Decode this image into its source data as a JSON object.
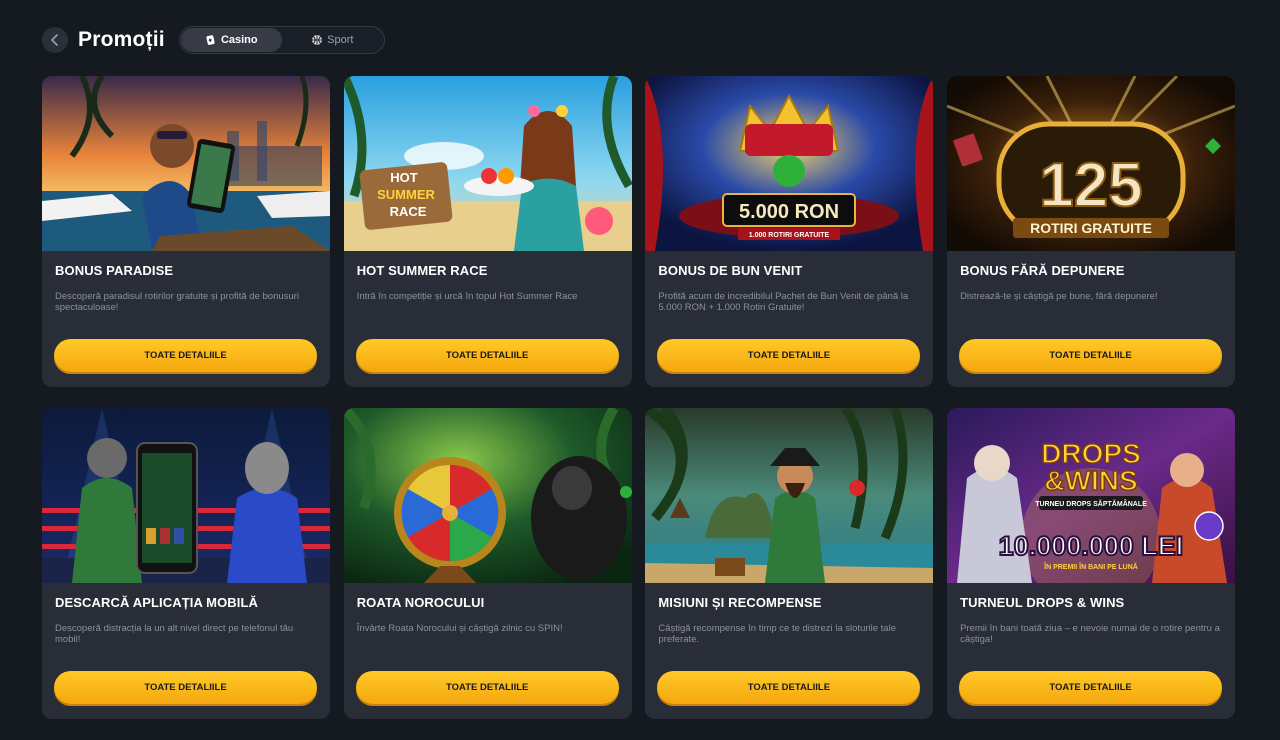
{
  "header": {
    "title": "Promoții",
    "tabs": [
      {
        "label": "Casino",
        "icon": "casino-chip-icon",
        "active": true
      },
      {
        "label": "Sport",
        "icon": "basketball-icon",
        "active": false
      }
    ]
  },
  "cards": [
    {
      "title": "BONUS PARADISE",
      "description": "Descoperă paradisul rotirilor gratuite și profită de bonusuri spectaculoase!",
      "button": "TOATE DETALIILE"
    },
    {
      "title": "HOT SUMMER RACE",
      "description": "Intră în competiție și urcă în topul Hot Summer Race",
      "button": "TOATE DETALIILE",
      "image_text": {
        "sign_line1": "HOT",
        "sign_line2": "SUMMER",
        "sign_line3": "RACE"
      }
    },
    {
      "title": "BONUS DE BUN VENIT",
      "description": "Profită acum de incredibilul Pachet de Bun Venit de până la 5.000 RON + 1.000 Rotiri Gratuite!",
      "button": "TOATE DETALIILE",
      "image_text": {
        "amount": "5.000 RON",
        "sub": "1.000 ROTIRI GRATUITE"
      }
    },
    {
      "title": "BONUS FĂRĂ DEPUNERE",
      "description": "Distrează-te și câștigă pe bune, fără depunere!",
      "button": "TOATE DETALIILE",
      "image_text": {
        "number": "125",
        "sub": "ROTIRI GRATUITE"
      }
    },
    {
      "title": "DESCARCĂ APLICAȚIA MOBILĂ",
      "description": "Descoperă distracția la un alt nivel direct pe telefonul tău mobil!",
      "button": "TOATE DETALIILE"
    },
    {
      "title": "ROATA NOROCULUI",
      "description": "Învârte Roata Norocului și câștigă zilnic cu SPIN!",
      "button": "TOATE DETALIILE"
    },
    {
      "title": "MISIUNI ȘI RECOMPENSE",
      "description": "Câștigă recompense în timp ce te distrezi la sloturile tale preferate.",
      "button": "TOATE DETALIILE"
    },
    {
      "title": "TURNEUL DROPS & WINS",
      "description": "Premii în bani toată ziua – e nevoie numai de o rotire pentru a câștiga!",
      "button": "TOATE DETALIILE",
      "image_text": {
        "line1": "DROPS",
        "line2": "&WINS",
        "banner": "TURNEU DROPS SĂPTĂMÂNALE",
        "amount": "10.000.000 LEI",
        "sub": "ÎN PREMII ÎN BANI PE LUNĂ"
      }
    }
  ],
  "colors": {
    "background": "#151920",
    "card": "#292d37",
    "button": "#ffc928",
    "text_muted": "#8c919b"
  }
}
